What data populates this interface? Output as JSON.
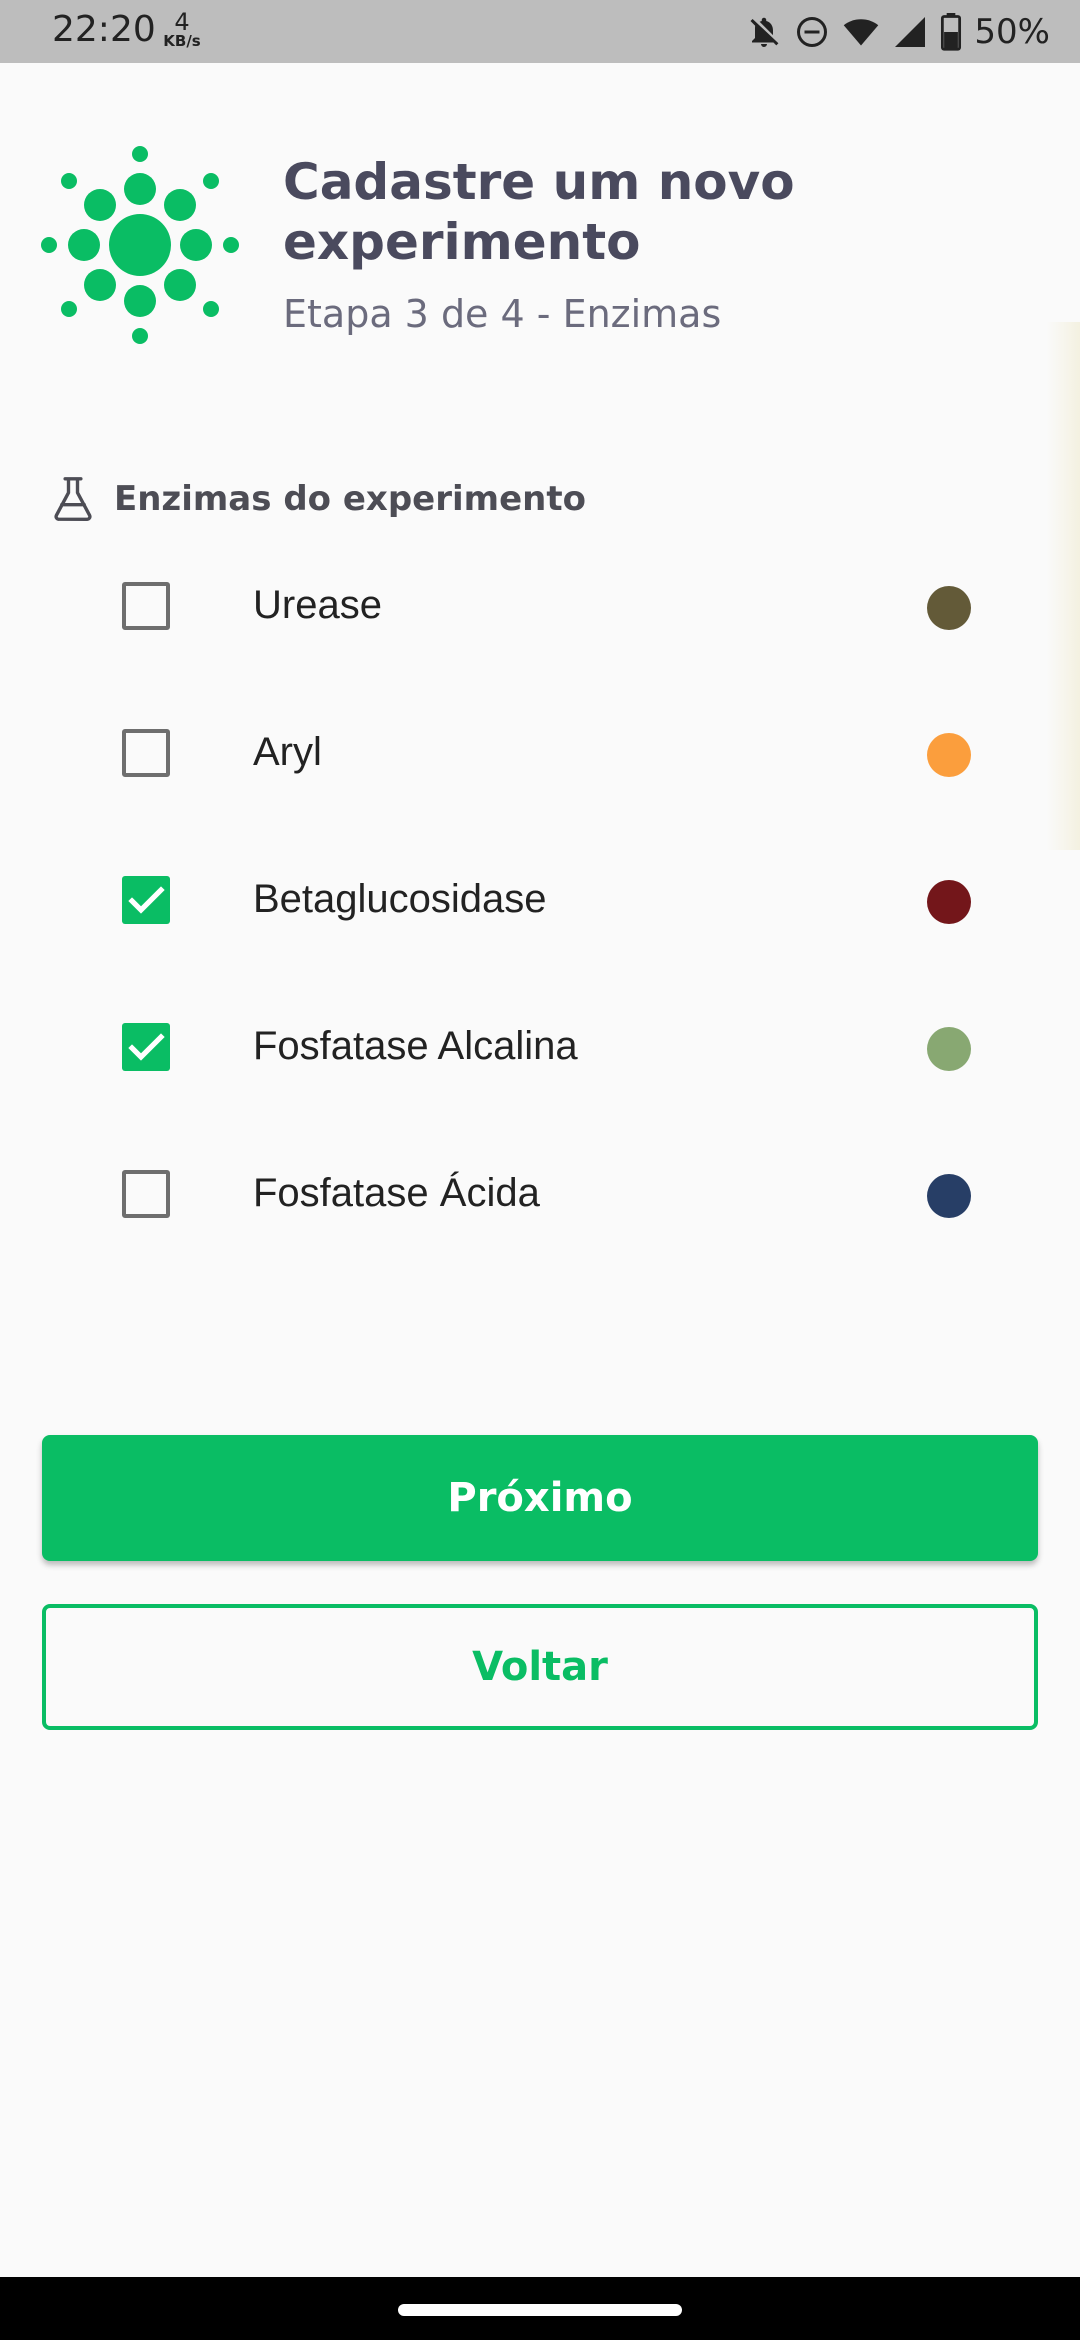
{
  "status_bar": {
    "time": "22:20",
    "net_speed_value": "4",
    "net_speed_unit": "KB/s",
    "battery_percent": "50%",
    "icons": [
      "notifications-off-icon",
      "do-not-disturb-icon",
      "wifi-icon",
      "cell-signal-icon",
      "battery-icon"
    ]
  },
  "header": {
    "logo_icon": "green-sun-logo-icon",
    "title": "Cadastre um novo experimento",
    "subtitle": "Etapa 3 de 4 - Enzimas"
  },
  "section": {
    "icon": "flask-icon",
    "title": "Enzimas do experimento"
  },
  "enzymes": [
    {
      "label": "Urease",
      "checked": false,
      "color": "#635a38"
    },
    {
      "label": "Aryl",
      "checked": false,
      "color": "#fb9e3d"
    },
    {
      "label": "Betaglucosidase",
      "checked": true,
      "color": "#73161a"
    },
    {
      "label": "Fosfatase Alcalina",
      "checked": true,
      "color": "#88a872"
    },
    {
      "label": "Fosfatase Ácida",
      "checked": false,
      "color": "#273e66"
    }
  ],
  "actions": {
    "next_label": "Próximo",
    "back_label": "Voltar"
  },
  "colors": {
    "accent": "#0abd64",
    "title_text": "#4a4a5e",
    "background": "#fafafa"
  }
}
